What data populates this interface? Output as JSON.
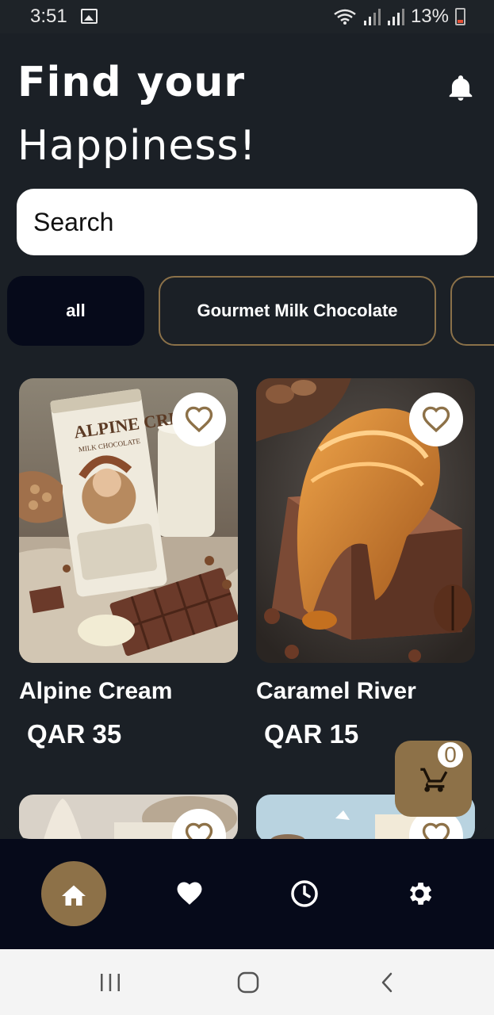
{
  "status_bar": {
    "time": "3:51",
    "battery": "13%"
  },
  "header": {
    "title_line1": "Find your",
    "title_line2": "Happiness!"
  },
  "search": {
    "placeholder": "Search"
  },
  "categories": [
    {
      "label": "all",
      "selected": true
    },
    {
      "label": "Gourmet Milk Chocolate",
      "selected": false
    },
    {
      "label": "",
      "selected": false
    }
  ],
  "products": [
    {
      "name": "Alpine Cream",
      "price": "QAR 35",
      "image_label": "ALPINE CREAM",
      "image_sublabel": "MILK CHOCOLATE"
    },
    {
      "name": "Caramel River",
      "price": "QAR 15"
    }
  ],
  "cart": {
    "count": "0"
  },
  "colors": {
    "accent": "#8d7148",
    "background": "#1b2026",
    "nav_background": "#060a1a"
  },
  "icons": {
    "header": "bell-icon",
    "favorite": "heart-outline-icon",
    "cart": "cart-icon",
    "nav": [
      "home-icon",
      "heart-icon",
      "clock-icon",
      "gear-icon"
    ],
    "system": [
      "recent-apps-icon",
      "home-circle-icon",
      "back-icon"
    ]
  }
}
